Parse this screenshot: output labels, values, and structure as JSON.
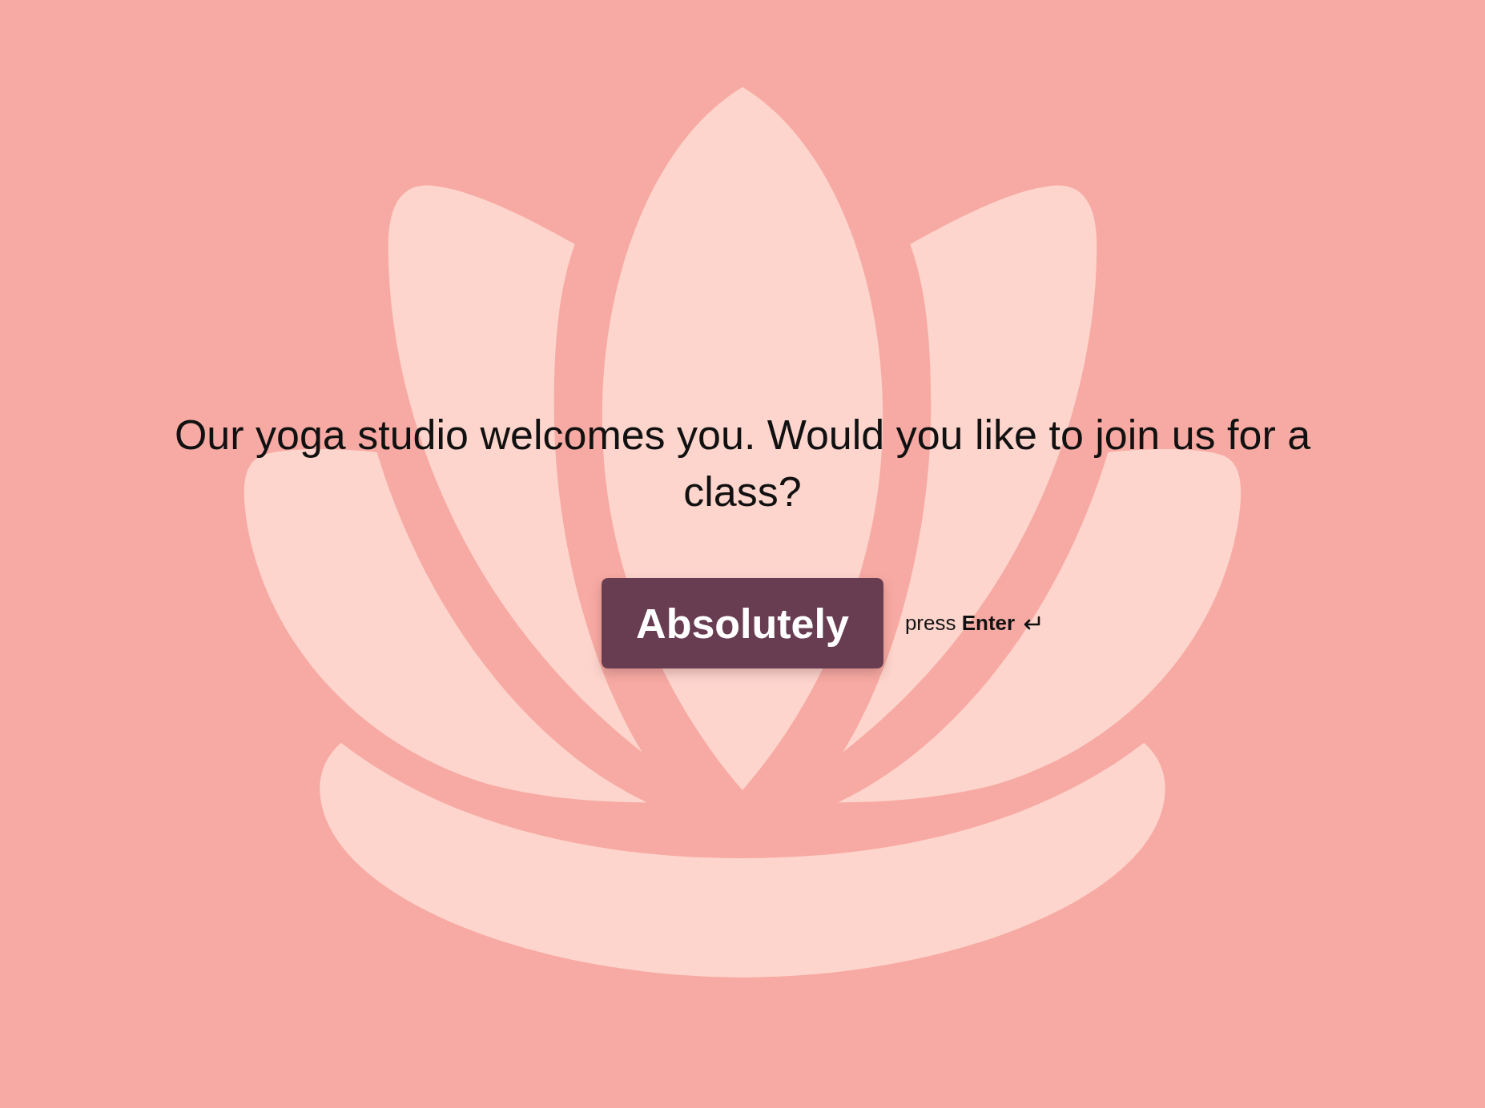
{
  "question": {
    "text": "Our yoga studio welcomes you. Would you like to join us for a class?"
  },
  "answer_button": {
    "label": "Absolutely"
  },
  "hint": {
    "text": "press **Enter**"
  }
}
